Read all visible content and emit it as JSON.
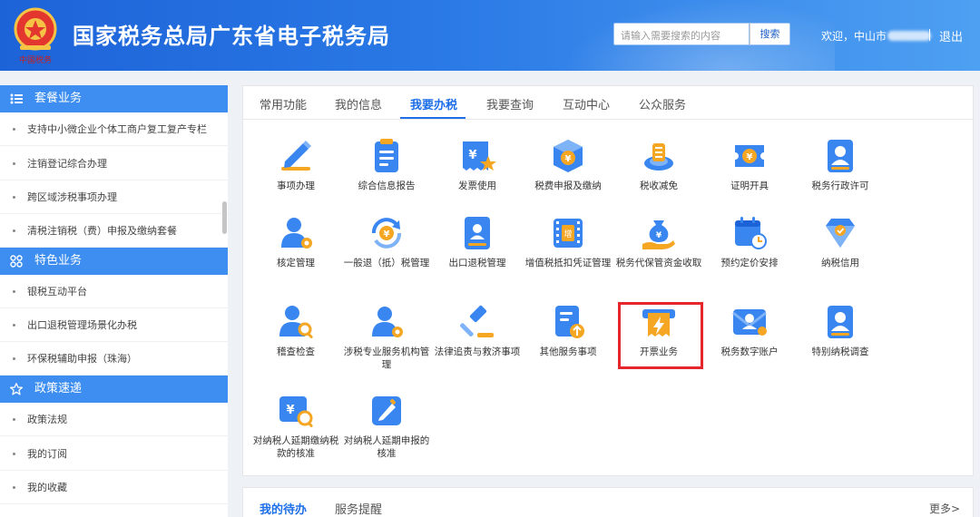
{
  "header": {
    "title": "国家税务总局广东省电子税务局",
    "search_placeholder": "请输入需要搜索的内容",
    "search_button": "搜索",
    "welcome": "欢迎，中山市",
    "logout": "退出",
    "emblem_caption": "中国税务"
  },
  "sidebar": {
    "sections": [
      {
        "title": "套餐业务",
        "icon": "list-icon",
        "items": [
          "支持中小微企业个体工商户复工复产专栏",
          "注销登记综合办理",
          "跨区域涉税事项办理",
          "清税注销税（费）申报及缴纳套餐"
        ]
      },
      {
        "title": "特色业务",
        "icon": "grid-icon",
        "items": [
          "银税互动平台",
          "出口退税管理场景化办税",
          "环保税辅助申报（珠海）"
        ]
      },
      {
        "title": "政策速递",
        "icon": "star-icon",
        "items": [
          "政策法规",
          "我的订阅",
          "我的收藏"
        ]
      }
    ]
  },
  "tabs": [
    "常用功能",
    "我的信息",
    "我要办税",
    "我要查询",
    "互动中心",
    "公众服务"
  ],
  "active_tab": "我要办税",
  "tiles": [
    {
      "label": "事项办理",
      "icon": "pen-icon"
    },
    {
      "label": "综合信息报告",
      "icon": "clipboard-icon"
    },
    {
      "label": "发票使用",
      "icon": "invoice-star-icon"
    },
    {
      "label": "税费申报及缴纳",
      "icon": "tax-box-icon"
    },
    {
      "label": "税收减免",
      "icon": "coins-icon"
    },
    {
      "label": "证明开具",
      "icon": "ticket-icon"
    },
    {
      "label": "税务行政许可",
      "icon": "badge-user-icon"
    },
    {
      "label": "核定管理",
      "icon": "user-gear-icon"
    },
    {
      "label": "一般退（抵）税管理",
      "icon": "refund-cycle-icon"
    },
    {
      "label": "出口退税管理",
      "icon": "book-user-icon"
    },
    {
      "label": "增值税抵扣凭证管理",
      "icon": "vat-film-icon"
    },
    {
      "label": "税务代保管资金收取",
      "icon": "money-bag-hand-icon"
    },
    {
      "label": "预约定价安排",
      "icon": "calendar-clock-icon"
    },
    {
      "label": "纳税信用",
      "icon": "diamond-check-icon"
    },
    {
      "label": "稽查检查",
      "icon": "user-search-icon"
    },
    {
      "label": "涉税专业服务机构管理",
      "icon": "user-settings-icon"
    },
    {
      "label": "法律追责与救济事项",
      "icon": "gavel-icon"
    },
    {
      "label": "其他服务事项",
      "icon": "doc-upload-icon"
    },
    {
      "label": "开票业务",
      "icon": "invoice-lightning-icon"
    },
    {
      "label": "税务数字账户",
      "icon": "envelope-user-icon"
    },
    {
      "label": "特别纳税调查",
      "icon": "badge-user-icon"
    },
    {
      "label": "对纳税人延期缴纳税款的核准",
      "icon": "tax-search-icon"
    },
    {
      "label": "对纳税人延期申报的核准",
      "icon": "pen-box-icon"
    }
  ],
  "bottom": {
    "tabs": [
      "我的待办",
      "服务提醒"
    ],
    "more": "更多>"
  }
}
